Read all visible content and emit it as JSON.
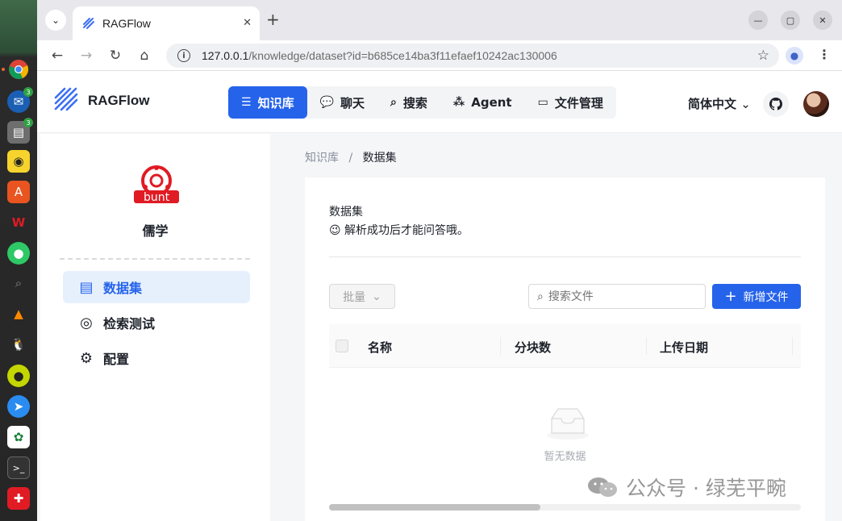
{
  "browser": {
    "tab_title": "RAGFlow",
    "url_host": "127.0.0.1",
    "url_path": "/knowledge/dataset?id=b685ce14ba3f11efaef10242ac130006"
  },
  "dock": {
    "items": [
      {
        "name": "chrome-icon",
        "badge": ""
      },
      {
        "name": "thunderbird-icon",
        "badge": "3"
      },
      {
        "name": "files-icon",
        "badge": "3"
      },
      {
        "name": "rhythmbox-icon",
        "badge": ""
      },
      {
        "name": "app-center-icon",
        "badge": ""
      },
      {
        "name": "wps-icon",
        "badge": ""
      },
      {
        "name": "wechat-icon",
        "badge": ""
      },
      {
        "name": "search-app-icon",
        "badge": ""
      },
      {
        "name": "vlc-icon",
        "badge": ""
      },
      {
        "name": "qq-icon",
        "badge": ""
      },
      {
        "name": "green-app-icon",
        "badge": ""
      },
      {
        "name": "feishu-icon",
        "badge": ""
      },
      {
        "name": "mindmap-icon",
        "badge": ""
      },
      {
        "name": "terminal-icon",
        "badge": ""
      },
      {
        "name": "red-app-icon",
        "badge": ""
      }
    ]
  },
  "header": {
    "brand": "RAGFlow",
    "nav": [
      {
        "label": "知识库",
        "active": true
      },
      {
        "label": "聊天",
        "active": false
      },
      {
        "label": "搜索",
        "active": false
      },
      {
        "label": "Agent",
        "active": false
      },
      {
        "label": "文件管理",
        "active": false
      }
    ],
    "language": "简体中文"
  },
  "sidebar": {
    "kb_logo_text": "bunt",
    "kb_name": "儒学",
    "items": [
      {
        "label": "数据集",
        "active": true
      },
      {
        "label": "检索测试",
        "active": false
      },
      {
        "label": "配置",
        "active": false
      }
    ]
  },
  "breadcrumb": {
    "root": "知识库",
    "separator": "/",
    "current": "数据集"
  },
  "main": {
    "title": "数据集",
    "description": "😉 解析成功后才能问答哦。",
    "batch_label": "批量",
    "search_placeholder": "搜索文件",
    "add_label": "新增文件",
    "columns": [
      "名称",
      "分块数",
      "上传日期"
    ],
    "empty_text": "暂无数据"
  },
  "watermark": {
    "text": "公众号 · 绿芜平畹"
  },
  "colors": {
    "primary": "#2563eb",
    "active_bg": "#e6f0fd"
  }
}
